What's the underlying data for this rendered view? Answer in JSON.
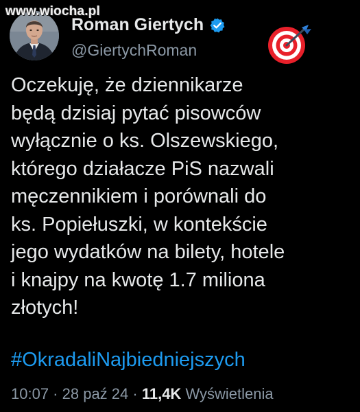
{
  "watermark": "www.wiocha.pl",
  "author": {
    "display_name": "Roman Giertych",
    "handle": "@GiertychRoman",
    "verified_icon": "verified-badge-icon",
    "badge_color": "#1d9bf0",
    "emoji_icon": "direct-hit-target-icon"
  },
  "tweet": {
    "lines": [
      "Oczekuję, że dziennikarze",
      "będą dzisiaj pytać pisowców",
      "wyłącznie o ks. Olszewskiego,",
      "którego działacze PiS nazwali",
      "męczennikiem i porównali do",
      "ks. Popiełuszki, w kontekście",
      "jego wydatków na bilety, hotele",
      "i knajpy na kwotę 1.7 miliona",
      "złotych!"
    ],
    "hashtag": "#OkradaliNajbiedniejszych",
    "hashtag_color": "#1d9bf0"
  },
  "meta": {
    "time": "10:07",
    "separator": " · ",
    "date": "28 paź 24",
    "views_count": "11,4K",
    "views_label": "Wyświetlenia"
  },
  "colors": {
    "background": "#000000",
    "text": "#e7e9ea",
    "secondary_text": "#8b98a5",
    "accent": "#1d9bf0"
  }
}
